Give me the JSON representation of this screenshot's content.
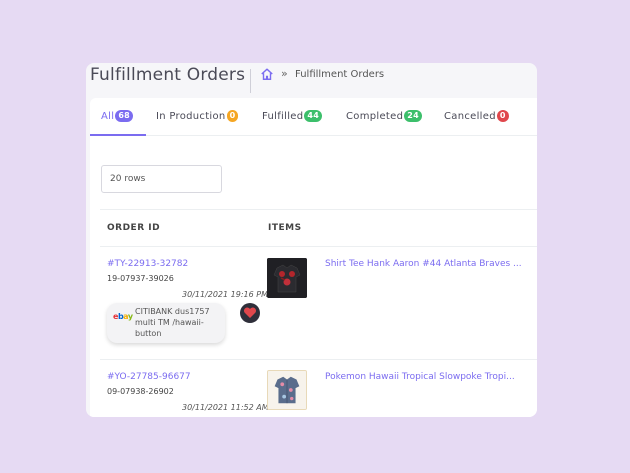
{
  "header": {
    "title": "Fulfillment Orders",
    "breadcrumb_separator": "»",
    "breadcrumb_current": "Fulfillment Orders"
  },
  "tabs": [
    {
      "label": "All",
      "count": "68",
      "color": "#7b6cf0"
    },
    {
      "label": "In Production",
      "count": "0",
      "color": "#f5a623"
    },
    {
      "label": "Fulfilled",
      "count": "44",
      "color": "#3cbf6b"
    },
    {
      "label": "Completed",
      "count": "24",
      "color": "#3cbf6b"
    },
    {
      "label": "Cancelled",
      "count": "0",
      "color": "#e0474c"
    }
  ],
  "rows_select": {
    "value": "20 rows"
  },
  "table": {
    "columns": [
      "ORDER ID",
      "ITEMS"
    ],
    "rows": [
      {
        "order_id": "#TY-22913-32782",
        "order_no": "19-07937-39026",
        "date": "30/11/2021 19:16 PM",
        "source": "ebay",
        "account": "CITIBANK dus1757 multi TM /hawaii-button",
        "item": "Shirt Tee Hank Aaron #44 Atlanta Braves ..."
      },
      {
        "order_id": "#YO-27785-96677",
        "order_no": "09-07938-26902",
        "date": "30/11/2021 11:52 AM",
        "item": "Pokemon Hawaii Tropical Slowpoke Tropi..."
      }
    ]
  },
  "colors": {
    "accent": "#7b6cf0",
    "background": "#e6daf3"
  }
}
